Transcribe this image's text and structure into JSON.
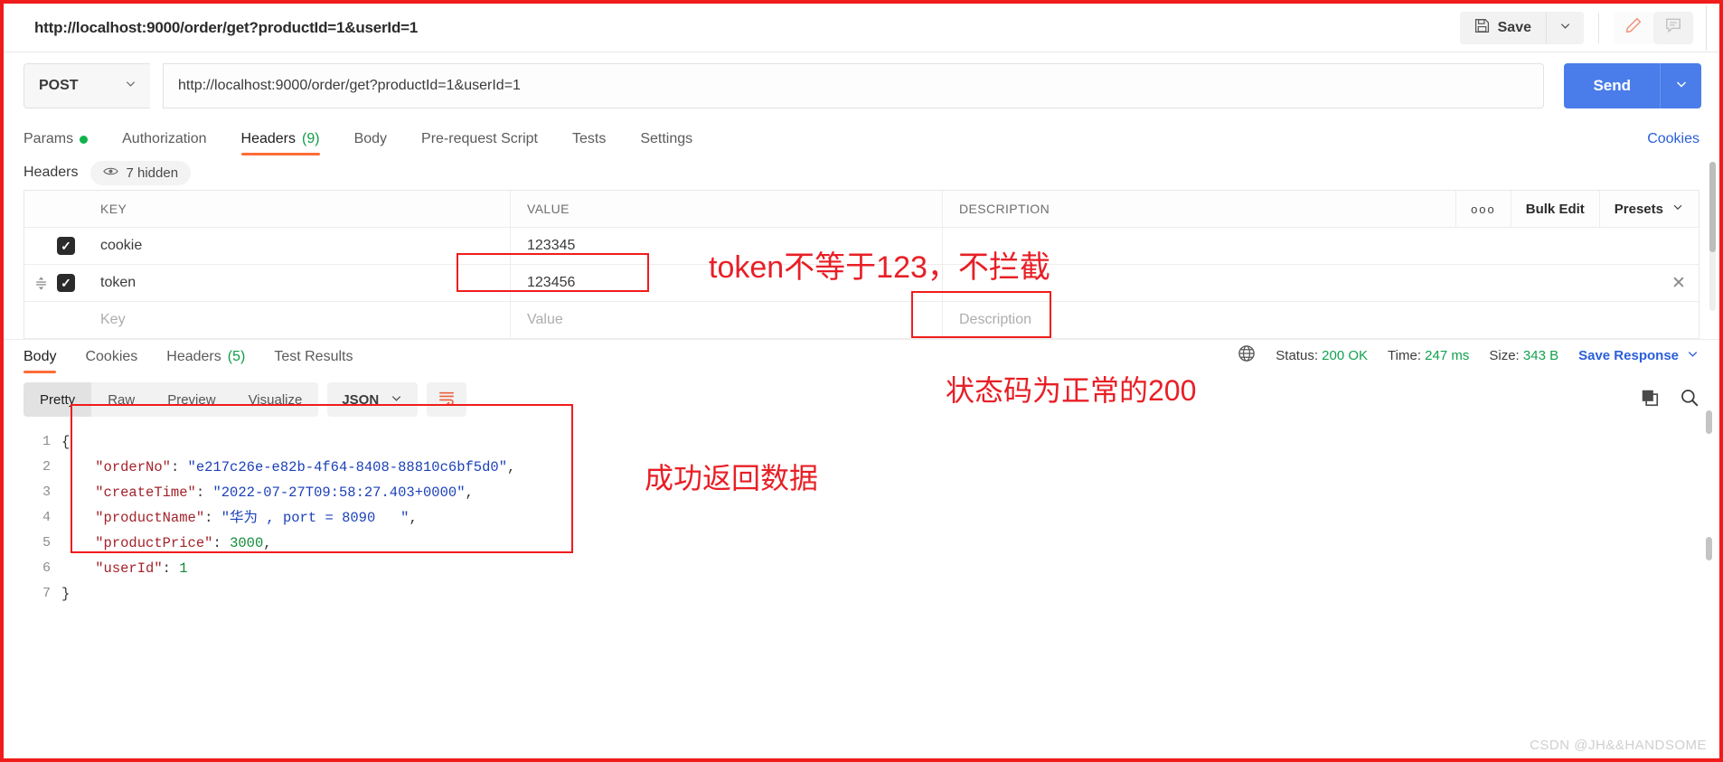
{
  "topbar": {
    "request_name": "http://localhost:9000/order/get?productId=1&userId=1",
    "save_label": "Save",
    "save_icon": "floppy-disk-icon",
    "save_caret_icon": "chevron-down-icon",
    "edit_icon": "pencil-icon",
    "comment_icon": "comment-icon"
  },
  "url_row": {
    "method": "POST",
    "method_caret_icon": "chevron-down-icon",
    "url": "http://localhost:9000/order/get?productId=1&userId=1",
    "send_label": "Send",
    "send_caret_icon": "chevron-down-icon"
  },
  "request_tabs": [
    {
      "label": "Params",
      "badge": "dot",
      "active": false
    },
    {
      "label": "Authorization",
      "badge": "",
      "active": false
    },
    {
      "label": "Headers",
      "count": "(9)",
      "active": true
    },
    {
      "label": "Body",
      "badge": "",
      "active": false
    },
    {
      "label": "Pre-request Script",
      "badge": "",
      "active": false
    },
    {
      "label": "Tests",
      "badge": "",
      "active": false
    },
    {
      "label": "Settings",
      "badge": "",
      "active": false
    }
  ],
  "cookies_link": "Cookies",
  "headers_subrow": {
    "label": "Headers",
    "eye_icon": "eye-icon",
    "hidden_label": "7 hidden"
  },
  "headers_table": {
    "columns": {
      "key": "KEY",
      "value": "VALUE",
      "description": "DESCRIPTION"
    },
    "tools": {
      "dots": "ooo",
      "bulk_edit": "Bulk Edit",
      "presets": "Presets",
      "presets_caret_icon": "chevron-down-icon"
    },
    "rows": [
      {
        "checked": true,
        "key": "cookie",
        "value": "123345",
        "description": ""
      },
      {
        "checked": true,
        "key": "token",
        "value": "123456",
        "description": ""
      }
    ],
    "placeholder_row": {
      "key": "Key",
      "value": "Value",
      "description": "Description"
    },
    "remove_icon": "close-icon",
    "drag_icon": "drag-handle-icon"
  },
  "response_tabs": [
    {
      "label": "Body",
      "active": true
    },
    {
      "label": "Cookies",
      "active": false
    },
    {
      "label": "Headers",
      "count": "(5)",
      "active": false
    },
    {
      "label": "Test Results",
      "active": false
    }
  ],
  "response_meta": {
    "globe_icon": "globe-icon",
    "status_label": "Status:",
    "status_value": "200 OK",
    "time_label": "Time:",
    "time_value": "247 ms",
    "size_label": "Size:",
    "size_value": "343 B",
    "save_response": "Save Response",
    "save_response_caret_icon": "chevron-down-icon"
  },
  "view_row": {
    "modes": [
      "Pretty",
      "Raw",
      "Preview",
      "Visualize"
    ],
    "active_mode": "Pretty",
    "format": "JSON",
    "format_caret_icon": "chevron-down-icon",
    "wrap_icon": "word-wrap-icon",
    "copy_icon": "copy-icon",
    "search_icon": "search-icon"
  },
  "response_body": {
    "line_numbers": [
      "1",
      "2",
      "3",
      "4",
      "5",
      "6",
      "7"
    ],
    "lines": [
      [
        {
          "t": "{",
          "c": "p"
        }
      ],
      [
        {
          "t": "    ",
          "c": "p"
        },
        {
          "t": "\"orderNo\"",
          "c": "k"
        },
        {
          "t": ": ",
          "c": "p"
        },
        {
          "t": "\"e217c26e-e82b-4f64-8408-88810c6bf5d0\"",
          "c": "s"
        },
        {
          "t": ",",
          "c": "p"
        }
      ],
      [
        {
          "t": "    ",
          "c": "p"
        },
        {
          "t": "\"createTime\"",
          "c": "k"
        },
        {
          "t": ": ",
          "c": "p"
        },
        {
          "t": "\"2022-07-27T09:58:27.403+0000\"",
          "c": "s"
        },
        {
          "t": ",",
          "c": "p"
        }
      ],
      [
        {
          "t": "    ",
          "c": "p"
        },
        {
          "t": "\"productName\"",
          "c": "k"
        },
        {
          "t": ": ",
          "c": "p"
        },
        {
          "t": "\"华为 , port = 8090   \"",
          "c": "s"
        },
        {
          "t": ",",
          "c": "p"
        }
      ],
      [
        {
          "t": "    ",
          "c": "p"
        },
        {
          "t": "\"productPrice\"",
          "c": "k"
        },
        {
          "t": ": ",
          "c": "p"
        },
        {
          "t": "3000",
          "c": "n"
        },
        {
          "t": ",",
          "c": "p"
        }
      ],
      [
        {
          "t": "    ",
          "c": "p"
        },
        {
          "t": "\"userId\"",
          "c": "k"
        },
        {
          "t": ": ",
          "c": "p"
        },
        {
          "t": "1",
          "c": "n"
        }
      ],
      [
        {
          "t": "}",
          "c": "p"
        }
      ]
    ]
  },
  "annotations": [
    {
      "id": "token-note",
      "text": "token不等于123，不拦截"
    },
    {
      "id": "status-note",
      "text": "状态码为正常的200"
    },
    {
      "id": "data-note",
      "text": "成功返回数据"
    }
  ],
  "watermark": "CSDN @JH&&HANDSOME",
  "colors": {
    "accent_orange": "#ff6c37",
    "send_blue": "#4a7dea",
    "link_blue": "#2a5fd8",
    "status_green": "#12a150",
    "annotation_red": "#e81f26",
    "frame_red": "#f01c1c"
  }
}
